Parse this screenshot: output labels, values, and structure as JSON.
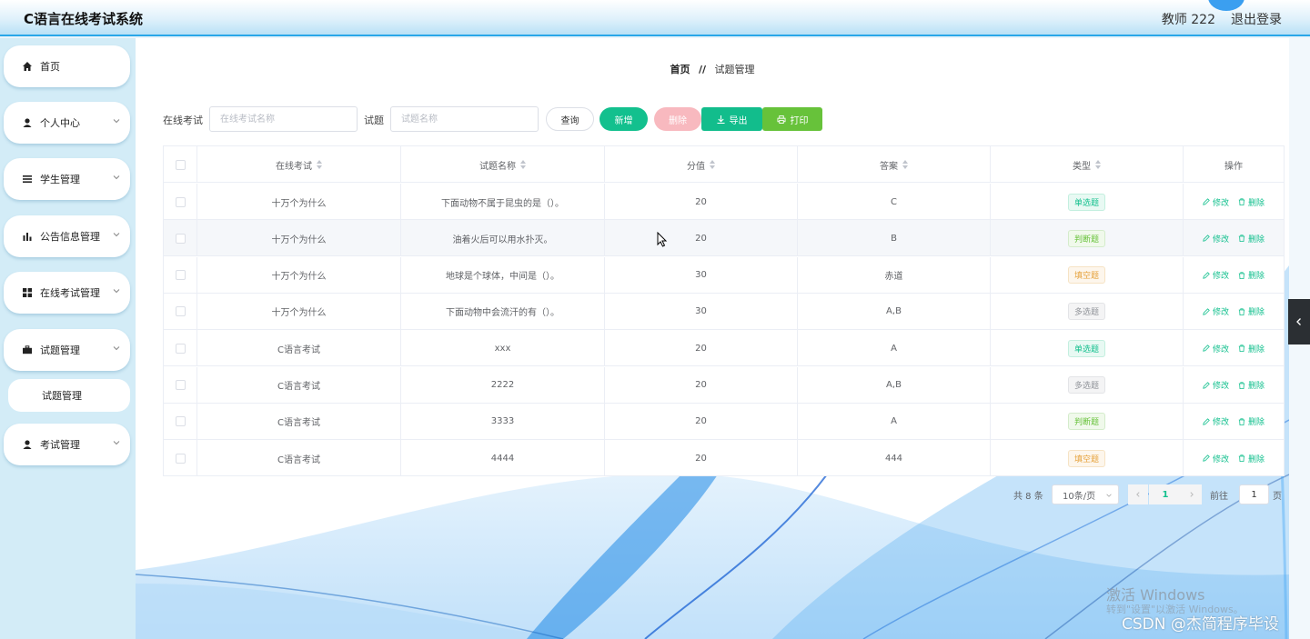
{
  "header": {
    "app_title": "C语言在线考试系统",
    "user_name": "教师 222",
    "logout_label": "退出登录"
  },
  "sidebar": {
    "items": [
      {
        "label": "首页",
        "icon": "home-icon"
      },
      {
        "label": "个人中心",
        "icon": "user-icon"
      },
      {
        "label": "学生管理",
        "icon": "list-icon"
      },
      {
        "label": "公告信息管理",
        "icon": "bar-chart-icon"
      },
      {
        "label": "在线考试管理",
        "icon": "grid-icon"
      },
      {
        "label": "试题管理",
        "icon": "briefcase-icon"
      },
      {
        "label": "考试管理",
        "icon": "user-icon"
      }
    ],
    "sub_item": "试题管理"
  },
  "breadcrumb": {
    "home": "首页",
    "separator": "//",
    "current": "试题管理"
  },
  "toolbar": {
    "exam_label": "在线考试",
    "exam_placeholder": "在线考试名称",
    "question_label": "试题",
    "question_placeholder": "试题名称",
    "query_label": "查询",
    "add_label": "新增",
    "delete_label": "删除",
    "export_label": "导出",
    "print_label": "打印"
  },
  "table": {
    "columns": [
      "在线考试",
      "试题名称",
      "分值",
      "答案",
      "类型",
      "操作"
    ],
    "rows": [
      {
        "exam": "十万个为什么",
        "question": "下面动物不属于昆虫的是（）。",
        "score": "20",
        "answer": "C",
        "type": "单选题"
      },
      {
        "exam": "十万个为什么",
        "question": "油着火后可以用水扑灭。",
        "score": "20",
        "answer": "B",
        "type": "判断题"
      },
      {
        "exam": "十万个为什么",
        "question": "地球是个球体，中间是（）。",
        "score": "30",
        "answer": "赤道",
        "type": "填空题"
      },
      {
        "exam": "十万个为什么",
        "question": "下面动物中会流汗的有（）。",
        "score": "30",
        "answer": "A,B",
        "type": "多选题"
      },
      {
        "exam": "C语言考试",
        "question": "xxx",
        "score": "20",
        "answer": "A",
        "type": "单选题"
      },
      {
        "exam": "C语言考试",
        "question": "2222",
        "score": "20",
        "answer": "A,B",
        "type": "多选题"
      },
      {
        "exam": "C语言考试",
        "question": "3333",
        "score": "20",
        "answer": "A",
        "type": "判断题"
      },
      {
        "exam": "C语言考试",
        "question": "4444",
        "score": "20",
        "answer": "444",
        "type": "填空题"
      }
    ],
    "edit_label": "修改",
    "delete_label": "删除"
  },
  "pagination": {
    "total": "共 8 条",
    "page_size": "10条/页",
    "current_page": "1",
    "goto_label": "前往",
    "goto_value": "1",
    "page_suffix": "页"
  },
  "watermarks": {
    "windows_line1": "激活 Windows",
    "windows_line2": "转到\"设置\"以激活 Windows。",
    "csdn": "CSDN @杰简程序毕设"
  },
  "colors": {
    "accent": "#13c08e",
    "header_border": "#29a7e8",
    "sidebar_bg": "#d3ecf7",
    "delete_btn": "#f8b9bf",
    "print_btn": "#67c23a"
  }
}
